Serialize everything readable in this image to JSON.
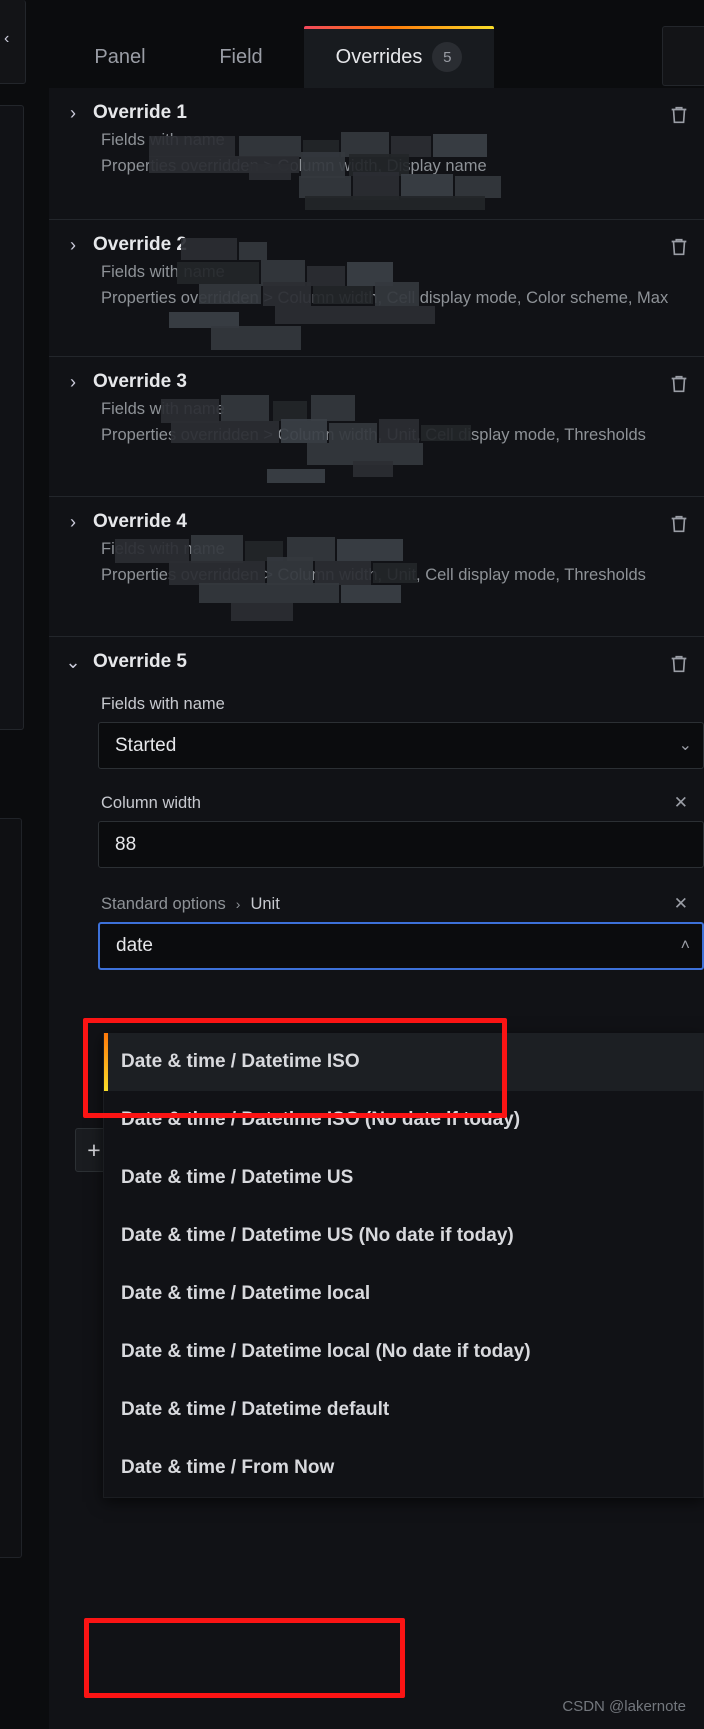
{
  "tabs": [
    {
      "label": "Panel",
      "badge": ""
    },
    {
      "label": "Field",
      "badge": ""
    },
    {
      "label": "Overrides",
      "badge": "5"
    }
  ],
  "icons": {
    "collapsed_chevron": "›",
    "expanded_chevron": "⌄",
    "trash": "🗑",
    "select_down": "⌄",
    "select_up": "˄",
    "clear_x": "✕",
    "crumb_sep": "›",
    "plus": "+",
    "left_chevron": "‹"
  },
  "overrides": [
    {
      "title": "Override 1",
      "expanded": false,
      "matcher_line": "Fields with name",
      "props_line": "Properties overridden > Column width, Display name"
    },
    {
      "title": "Override 2",
      "expanded": false,
      "matcher_line": "Fields with name",
      "props_line": "Properties overridden > Column width, Cell display mode, Color scheme, Max"
    },
    {
      "title": "Override 3",
      "expanded": false,
      "matcher_line": "Fields with name",
      "props_line": "Properties overridden > Column width, Unit, Cell display mode, Thresholds"
    },
    {
      "title": "Override 4",
      "expanded": false,
      "matcher_line": "Fields with name",
      "props_line": "Properties overridden > Column width, Unit, Cell display mode, Thresholds"
    },
    {
      "title": "Override 5",
      "expanded": true
    }
  ],
  "override5": {
    "matcher_label": "Fields with name",
    "matcher_value": "Started",
    "column_width_label": "Column width",
    "column_width_value": "88",
    "unit_breadcrumb_root": "Standard options",
    "unit_breadcrumb_leaf": "Unit",
    "unit_input_value": "date"
  },
  "unit_dropdown": {
    "open": true,
    "options": [
      {
        "label": "Date & time / Datetime ISO",
        "active": true
      },
      {
        "label": "Date & time / Datetime ISO (No date if today)",
        "active": false
      },
      {
        "label": "Date & time / Datetime US",
        "active": false
      },
      {
        "label": "Date & time / Datetime US (No date if today)",
        "active": false
      },
      {
        "label": "Date & time / Datetime local",
        "active": false
      },
      {
        "label": "Date & time / Datetime local (No date if today)",
        "active": false
      },
      {
        "label": "Date & time / Datetime default",
        "active": false
      },
      {
        "label": "Date & time / From Now",
        "active": false
      }
    ]
  },
  "annotations": {
    "unit_box_color": "#fb1414",
    "from_now_box_color": "#fb1414",
    "focus_border_color": "#3d71d9",
    "active_bar_color": "#ff780a"
  },
  "watermark": "CSDN @lakernote"
}
